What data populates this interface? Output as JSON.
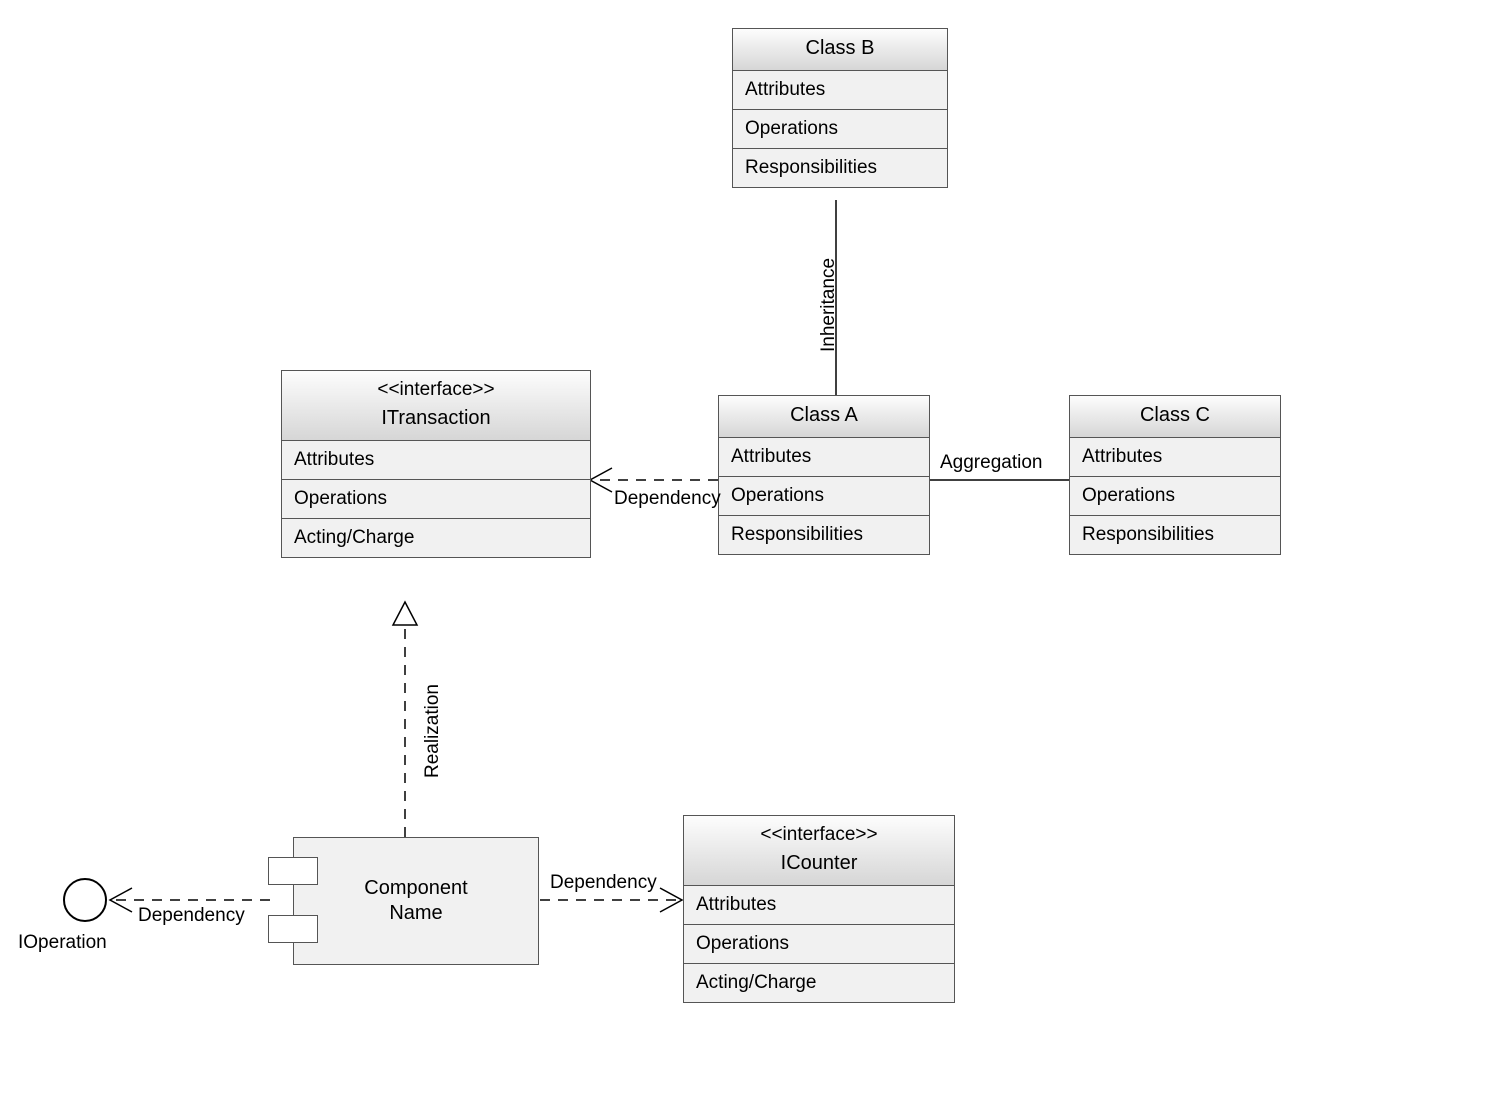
{
  "classes": {
    "itransaction": {
      "stereotype": "<<interface>>",
      "name": "ITransaction",
      "rows": [
        "Attributes",
        "Operations",
        "Acting/Charge"
      ]
    },
    "classB": {
      "name": "Class B",
      "rows": [
        "Attributes",
        "Operations",
        "Responsibilities"
      ]
    },
    "classA": {
      "name": "Class A",
      "rows": [
        "Attributes",
        "Operations",
        "Responsibilities"
      ]
    },
    "classC": {
      "name": "Class C",
      "rows": [
        "Attributes",
        "Operations",
        "Responsibilities"
      ]
    },
    "icounter": {
      "stereotype": "<<interface>>",
      "name": "ICounter",
      "rows": [
        "Attributes",
        "Operations",
        "Acting/Charge"
      ]
    }
  },
  "component": {
    "line1": "Component",
    "line2": "Name"
  },
  "lollipop": {
    "name": "IOperation"
  },
  "labels": {
    "inheritance": "Inheritance",
    "dependency_a_itrans": "Dependency",
    "aggregation": "Aggregation",
    "realization": "Realization",
    "dependency_comp_icounter": "Dependency",
    "dependency_comp_ioperation": "Dependency"
  }
}
